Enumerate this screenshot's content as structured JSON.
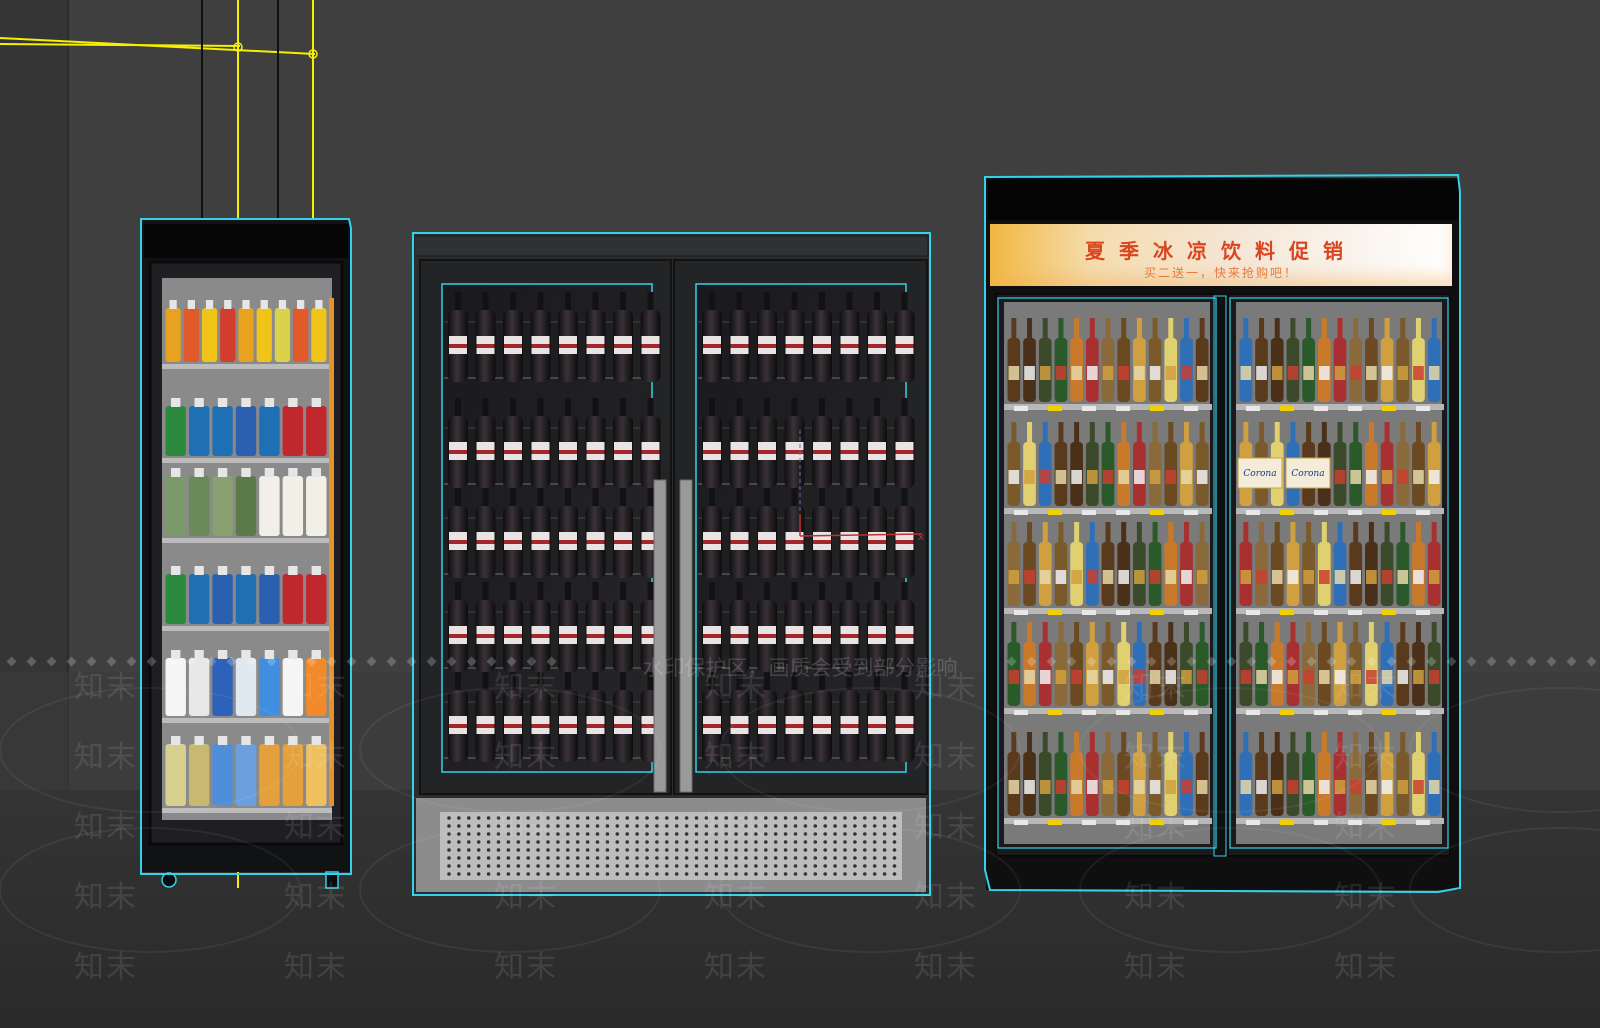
{
  "viewport": {
    "watermark_text": "知末",
    "banner_text": "水印保护区，画质会受到部分影响"
  },
  "promo_banner": {
    "title": "夏季冰凉饮料促销",
    "subtitle": "买二送一，快来抢购吧！"
  },
  "brand_labels": {
    "corona": "Corona"
  },
  "colors": {
    "background": "#3c3c3c",
    "floor": "#2d2d2d",
    "selection_outline": "#32d2ea",
    "guide_line": "#f4f000"
  }
}
